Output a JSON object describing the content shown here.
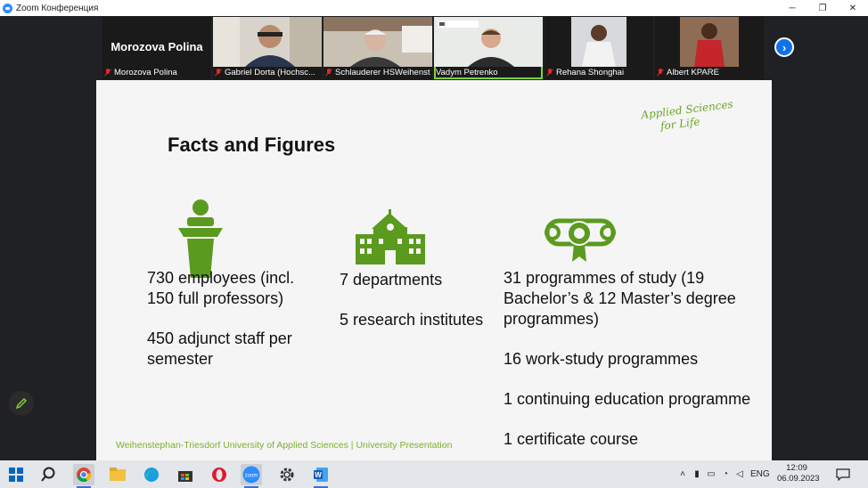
{
  "window": {
    "title": "Zoom Конференция",
    "controls": [
      "minimize",
      "restore",
      "close"
    ]
  },
  "participants": [
    {
      "name": "Morozova Polina",
      "label": "Morozova Polina",
      "video": false,
      "muted": true
    },
    {
      "name": "Gabriel Dorta",
      "label": "Gabriel Dorta (Hochsc...",
      "video": true,
      "muted": true
    },
    {
      "name": "Schlauderer HSWeihenstephan",
      "label": "Schlauderer HSWeihenste...",
      "video": true,
      "muted": true
    },
    {
      "name": "Vadym Petrenko",
      "label": "Vadym Petrenko",
      "video": true,
      "muted": false,
      "active": true
    },
    {
      "name": "Rehana Shonghai",
      "label": "Rehana Shonghai",
      "video": true,
      "muted": true
    },
    {
      "name": "Albert KPARE",
      "label": "Albert KPARE",
      "video": true,
      "muted": true
    }
  ],
  "slide": {
    "title": "Facts and Figures",
    "tagline": [
      "Applied Sciences",
      "for Life"
    ],
    "col1": {
      "p1": "730 employees (incl. 150 full professors)",
      "p2": "450 adjunct staff per semester"
    },
    "col2": {
      "p1": "7 departments",
      "p2": "5 research institutes"
    },
    "col3": {
      "p1": "31 programmes of study (19 Bachelor’s & 12 Master’s degree programmes)",
      "p2": "16 work-study programmes",
      "p3": "1 continuing education programme",
      "p4": "1 certificate course"
    },
    "footer": "Weihenstephan-Triesdorf University of Applied Sciences | University Presentation",
    "accent_color": "#5a9a1e",
    "icons": [
      "lectern-icon",
      "school-building-icon",
      "diploma-icon"
    ]
  },
  "taskbar": {
    "apps": [
      "windows-start",
      "search",
      "chrome",
      "file-explorer",
      "edge",
      "store",
      "opera",
      "zoom",
      "settings",
      "word"
    ],
    "language": "ENG",
    "time": "12:09",
    "date": "06.09.2023"
  }
}
